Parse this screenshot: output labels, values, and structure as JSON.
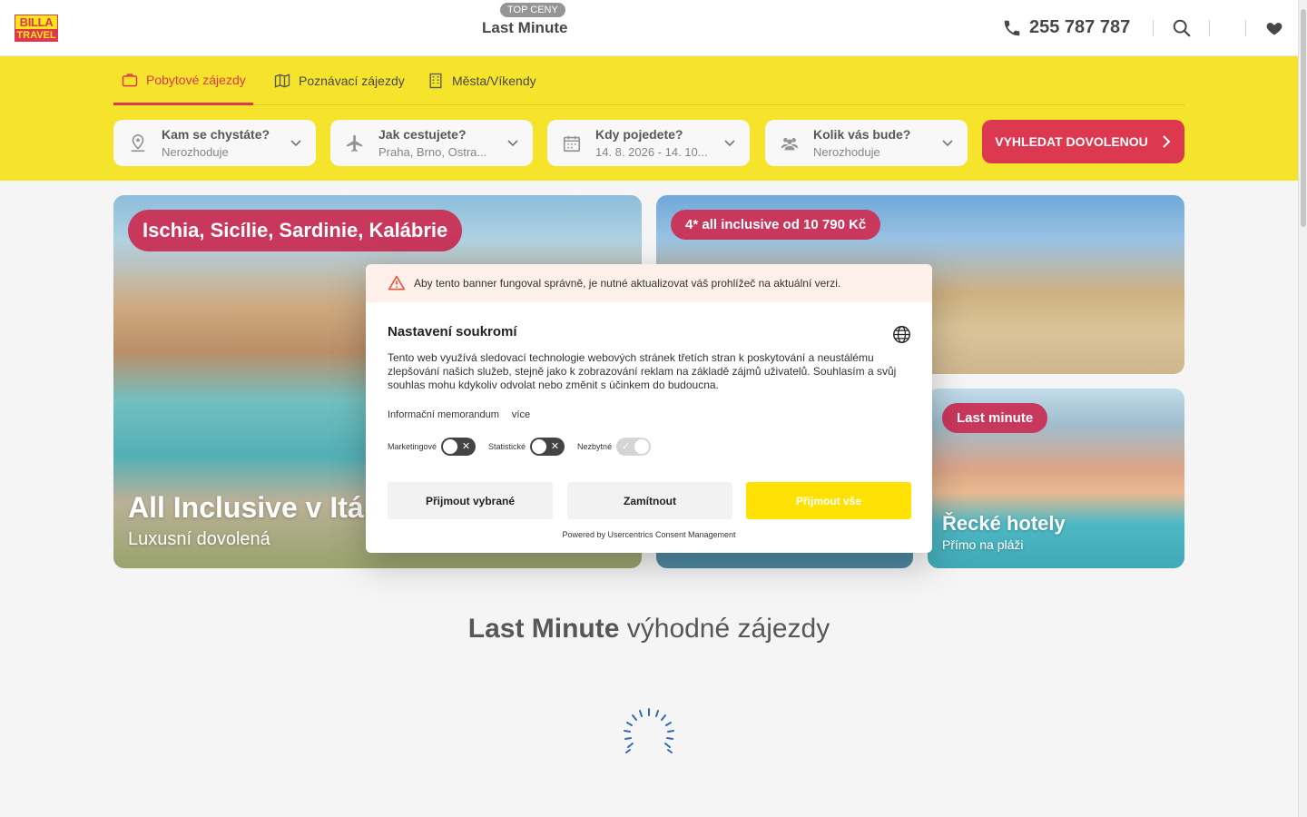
{
  "header": {
    "brand_line1": "BILLA",
    "brand_line2": "TRAVEL",
    "badge": "TOP CENY",
    "title": "Last Minute",
    "phone": "255 787 787"
  },
  "colors": {
    "accent_red": "#d9233e",
    "brand_yellow": "#f4e114",
    "button_yellow": "#ffe203"
  },
  "tabs": [
    {
      "label": "Pobytové zájezdy",
      "icon": "suitcase-icon",
      "active": true
    },
    {
      "label": "Poznávací zájezdy",
      "icon": "map-icon",
      "active": false
    },
    {
      "label": "Města/Víkendy",
      "icon": "building-icon",
      "active": false
    }
  ],
  "search": {
    "fields": [
      {
        "label": "Kam se chystáte?",
        "value": "Nerozhoduje",
        "icon": "location-pin-icon"
      },
      {
        "label": "Jak cestujete?",
        "value": "Praha, Brno, Ostra...",
        "icon": "airplane-icon"
      },
      {
        "label": "Kdy pojedete?",
        "value": "14. 8. 2026 - 14. 10...",
        "icon": "calendar-icon"
      },
      {
        "label": "Kolik vás bude?",
        "value": "Nerozhoduje",
        "icon": "people-icon"
      }
    ],
    "submit_label": "VYHLEDAT DOVOLENOU"
  },
  "banners": [
    {
      "pill": "Ischia, Sicílie, Sardinie, Kalábrie",
      "title": "All Inclusive v Itál",
      "subtitle": "Luxusní dovolená"
    },
    {
      "pill": "4* all inclusive od 10 790 Kč"
    },
    {},
    {
      "pill": "Last minute",
      "title": "Řecké hotely",
      "subtitle": "Přímo na pláži"
    }
  ],
  "section": {
    "title_bold": "Last Minute",
    "title_rest": " výhodné zájezdy"
  },
  "consent": {
    "warning": "Aby tento banner fungoval správně, je nutné aktualizovat váš prohlížeč na aktuální verzi.",
    "title": "Nastavení soukromí",
    "description": "Tento web využívá sledovací technologie webových stránek třetích stran k poskytování a neustálému zlepšování našich služeb, stejně jako k zobrazování reklam na základě zájmů uživatelů. Souhlasím a svůj souhlas mohu kdykoliv odvolat nebo změnit s účinkem do budoucna.",
    "link_memorandum": "Informační memorandum",
    "link_more": "více",
    "toggles": [
      {
        "label": "Marketingové",
        "on": false
      },
      {
        "label": "Statistické",
        "on": false
      },
      {
        "label": "Nezbytné",
        "on": true
      }
    ],
    "btn_accept_selected": "Přijmout vybrané",
    "btn_reject": "Zamítnout",
    "btn_accept_all": "Přijmout vše",
    "powered_by": "Powered by Usercentrics Consent Management"
  }
}
